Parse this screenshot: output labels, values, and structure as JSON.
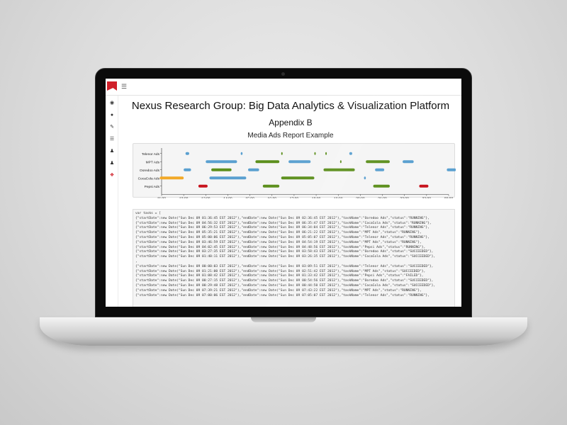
{
  "page": {
    "title": "Nexus Research Group: Big Data Analytics & Visualization Platform",
    "subtitle": "Appendix B",
    "chart_title": "Media Ads Report Example"
  },
  "header": {
    "menu_icon": "hamburger-icon",
    "logo": "brand-logo"
  },
  "sidebar": {
    "icons": [
      "dashboard-icon",
      "chart-icon",
      "edit-icon",
      "list-icon",
      "users-icon",
      "user-add-icon",
      "tools-icon"
    ]
  },
  "colors": {
    "running": "#5aa0d0",
    "succeeded": "#5c8f1c",
    "failed": "#c8141e",
    "killed": "#f2a928"
  },
  "chart_data": {
    "type": "gantt",
    "title": "Media Ads Report Example",
    "x_ticks": [
      "11:00",
      "12:00",
      "13:00",
      "14:00",
      "15:00",
      "16:00",
      "17:00",
      "18:00",
      "19:00",
      "20:00",
      "21:00",
      "22:00",
      "23:00",
      "00:00"
    ],
    "categories": [
      "Telenor Ads",
      "MPT Ads",
      "Ooredoo Ads",
      "CocaCola Ads",
      "Pepsi Ads"
    ],
    "tasks": [
      {
        "task": "Telenor Ads",
        "start": "12:05",
        "end": "12:15",
        "status": "RUNNING"
      },
      {
        "task": "Telenor Ads",
        "start": "14:35",
        "end": "14:40",
        "status": "RUNNING"
      },
      {
        "task": "Telenor Ads",
        "start": "16:25",
        "end": "16:28",
        "status": "SUCCEEDED"
      },
      {
        "task": "Telenor Ads",
        "start": "17:55",
        "end": "17:58",
        "status": "SUCCEEDED"
      },
      {
        "task": "Telenor Ads",
        "start": "18:25",
        "end": "18:28",
        "status": "SUCCEEDED"
      },
      {
        "task": "Telenor Ads",
        "start": "19:30",
        "end": "19:38",
        "status": "RUNNING"
      },
      {
        "task": "MPT Ads",
        "start": "13:00",
        "end": "14:25",
        "status": "RUNNING"
      },
      {
        "task": "MPT Ads",
        "start": "15:15",
        "end": "16:20",
        "status": "SUCCEEDED"
      },
      {
        "task": "MPT Ads",
        "start": "16:45",
        "end": "17:45",
        "status": "RUNNING"
      },
      {
        "task": "MPT Ads",
        "start": "19:05",
        "end": "19:08",
        "status": "SUCCEEDED"
      },
      {
        "task": "MPT Ads",
        "start": "20:15",
        "end": "21:20",
        "status": "SUCCEEDED"
      },
      {
        "task": "MPT Ads",
        "start": "21:55",
        "end": "22:25",
        "status": "RUNNING"
      },
      {
        "task": "Ooredoo Ads",
        "start": "12:00",
        "end": "12:20",
        "status": "RUNNING"
      },
      {
        "task": "Ooredoo Ads",
        "start": "13:15",
        "end": "14:10",
        "status": "SUCCEEDED"
      },
      {
        "task": "Ooredoo Ads",
        "start": "14:55",
        "end": "15:25",
        "status": "RUNNING"
      },
      {
        "task": "Ooredoo Ads",
        "start": "18:20",
        "end": "19:45",
        "status": "SUCCEEDED"
      },
      {
        "task": "Ooredoo Ads",
        "start": "20:40",
        "end": "21:05",
        "status": "RUNNING"
      },
      {
        "task": "Ooredoo Ads",
        "start": "23:55",
        "end": "00:20",
        "status": "RUNNING"
      },
      {
        "task": "CocaCola Ads",
        "start": "10:55",
        "end": "12:00",
        "status": "KILLED"
      },
      {
        "task": "CocaCola Ads",
        "start": "13:10",
        "end": "14:50",
        "status": "RUNNING"
      },
      {
        "task": "CocaCola Ads",
        "start": "16:25",
        "end": "17:55",
        "status": "SUCCEEDED"
      },
      {
        "task": "CocaCola Ads",
        "start": "20:10",
        "end": "20:15",
        "status": "RUNNING"
      },
      {
        "task": "Pepsi Ads",
        "start": "12:40",
        "end": "13:05",
        "status": "FAILED"
      },
      {
        "task": "Pepsi Ads",
        "start": "15:35",
        "end": "16:20",
        "status": "SUCCEEDED"
      },
      {
        "task": "Pepsi Ads",
        "start": "20:35",
        "end": "21:20",
        "status": "SUCCEEDED"
      },
      {
        "task": "Pepsi Ads",
        "start": "22:40",
        "end": "23:05",
        "status": "FAILED"
      }
    ]
  },
  "code_lines": [
    "var tasks = [",
    "{\"startDate\":new Date(\"Sun Dec 09 01:36:45 EST 2012\"),\"endDate\":new Date(\"Sun Dec 09 02:36:45 EST 2012\"),\"taskName\":\"Ooredoo Ads\",\"status\":\"RUNNING\"},",
    "{\"startDate\":new Date(\"Sun Dec 09 04:56:32 EST 2012\"),\"endDate\":new Date(\"Sun Dec 09 06:35:47 EST 2012\"),\"taskName\":\"CocaCola Ads\",\"status\":\"RUNNING\"},",
    "{\"startDate\":new Date(\"Sun Dec 09 06:29:53 EST 2012\"),\"endDate\":new Date(\"Sun Dec 09 06:34:04 EST 2012\"),\"taskName\":\"Telenor Ads\",\"status\":\"RUNNING\"},",
    "{\"startDate\":new Date(\"Sun Dec 09 05:35:21 EST 2012\"),\"endDate\":new Date(\"Sun Dec 09 06:21:22 EST 2012\"),\"taskName\":\"MPT Ads\",\"status\":\"RUNNING\"},",
    "{\"startDate\":new Date(\"Sun Dec 09 05:00:06 EST 2012\"),\"endDate\":new Date(\"Sun Dec 09 05:05:07 EST 2012\"),\"taskName\":\"Telenor Ads\",\"status\":\"RUNNING\"},",
    "{\"startDate\":new Date(\"Sun Dec 09 03:46:59 EST 2012\"),\"endDate\":new Date(\"Sun Dec 09 04:54:19 EST 2012\"),\"taskName\":\"MPT Ads\",\"status\":\"RUNNING\"},",
    "{\"startDate\":new Date(\"Sun Dec 09 04:02:45 EST 2012\"),\"endDate\":new Date(\"Sun Dec 09 04:48:56 EST 2012\"),\"taskName\":\"Pepsi Ads\",\"status\":\"RUNNING\"},",
    "{\"startDate\":new Date(\"Sun Dec 09 03:27:35 EST 2012\"),\"endDate\":new Date(\"Sun Dec 09 03:58:43 EST 2012\"),\"taskName\":\"Ooredoo Ads\",\"status\":\"SUCCEEDED\"},",
    "{\"startDate\":new Date(\"Sun Dec 09 01:40:11 EST 2012\"),\"endDate\":new Date(\"Sun Dec 09 03:26:35 EST 2012\"),\"taskName\":\"CocaCola Ads\",\"status\":\"SUCCEEDED\"},",
    ",",
    "{\"startDate\":new Date(\"Sun Dec 09 00:00:03 EST 2012\"),\"endDate\":new Date(\"Sun Dec 09 03:09:51 EST 2012\"),\"taskName\":\"Telenor Ads\",\"status\":\"SUCCEEDED\"},",
    "{\"startDate\":new Date(\"Sun Dec 09 01:21:00 EST 2012\"),\"endDate\":new Date(\"Sun Dec 09 02:51:42 EST 2012\"),\"taskName\":\"MPT Ads\",\"status\":\"SUCCEEDED\"},",
    "{\"startDate\":new Date(\"Sun Dec 09 01:08:42 EST 2012\"),\"endDate\":new Date(\"Sun Dec 09 01:33:42 EST 2012\"),\"taskName\":\"Pepsi Ads\",\"status\":\"FAILED\"},",
    "{\"startDate\":new Date(\"Sun Dec 09 00:27:15 EST 2012\"),\"endDate\":new Date(\"Sun Dec 09 00:54:56 EST 2012\"),\"taskName\":\"Ooredoo Ads\",\"status\":\"SUCCEEDED\"},",
    "{\"startDate\":new Date(\"Sun Dec 09 00:29:48 EST 2012\"),\"endDate\":new Date(\"Sun Dec 09 00:44:50 EST 2012\"),\"taskName\":\"CocaCola Ads\",\"status\":\"SUCCEEDED\"},",
    "{\"startDate\":new Date(\"Sun Dec 09 07:39:21 EST 2012\"),\"endDate\":new Date(\"Sun Dec 09 07:43:22 EST 2012\"),\"taskName\":\"MPT Ads\",\"status\":\"RUNNING\"},",
    "{\"startDate\":new Date(\"Sun Dec 09 07:00:06 EST 2012\"),\"endDate\":new Date(\"Sun Dec 09 07:05:07 EST 2012\"),\"taskName\":\"Telenor Ads\",\"status\":\"RUNNING\"},"
  ]
}
